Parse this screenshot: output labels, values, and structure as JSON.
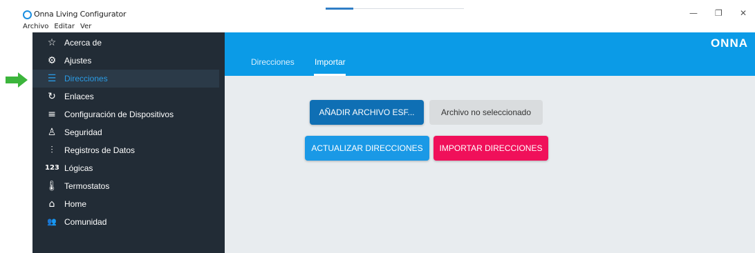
{
  "window": {
    "title": "Onna Living Configurator",
    "minimize_icon": "—",
    "maximize_icon": "❐",
    "close_icon": "✕"
  },
  "menu": [
    "Archivo",
    "Editar",
    "Ver"
  ],
  "sidebar": {
    "items": [
      {
        "label": "Acerca de",
        "icon": "star-outline-icon",
        "glyph": "☆"
      },
      {
        "label": "Ajustes",
        "icon": "gear-icon",
        "glyph": "⚙"
      },
      {
        "label": "Direcciones",
        "icon": "list-icon",
        "glyph": "☰"
      },
      {
        "label": "Enlaces",
        "icon": "refresh-icon",
        "glyph": "↻"
      },
      {
        "label": "Configuración de Dispositivos",
        "icon": "device-config-icon",
        "glyph": "≡"
      },
      {
        "label": "Seguridad",
        "icon": "alarm-light-icon",
        "glyph": "♙"
      },
      {
        "label": "Registros de Datos",
        "icon": "data-chart-icon",
        "glyph": "⫶"
      },
      {
        "label": "Lógicas",
        "icon": "numeric-icon",
        "glyph": "123"
      },
      {
        "label": "Termostatos",
        "icon": "thermometer-icon",
        "glyph": "🌡"
      },
      {
        "label": "Home",
        "icon": "home-icon",
        "glyph": "⌂"
      },
      {
        "label": "Comunidad",
        "icon": "community-icon",
        "glyph": "👥"
      }
    ],
    "active": "Direcciones"
  },
  "header": {
    "brand": "ONNA",
    "tabs": [
      "Direcciones",
      "Importar"
    ],
    "active_tab": "Importar"
  },
  "import": {
    "add_file_label": "AÑADIR ARCHIVO ESF...",
    "file_status": "Archivo no seleccionado",
    "update_label": "ACTUALIZAR DIRECCIONES",
    "import_label": "IMPORTAR DIRECCIONES"
  },
  "colors": {
    "sidebar_bg": "#222c36",
    "header_bg": "#0b9be7",
    "accent_blue": "#1a99e6",
    "import_pink": "#f0105a",
    "annotation_green": "#3cb53c"
  }
}
